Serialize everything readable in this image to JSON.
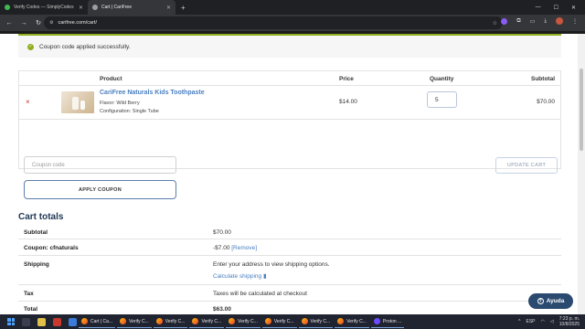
{
  "browser": {
    "tabs": [
      {
        "title": "Verify Codes — SimplyCodes",
        "fav_color": "#3fb950"
      },
      {
        "title": "Cart | CariFree",
        "fav_color": "#9aa0a6"
      }
    ],
    "url": "carifree.com/cart/"
  },
  "notice": {
    "message": "Coupon code applied successfully."
  },
  "cart": {
    "headers": {
      "product": "Product",
      "price": "Price",
      "quantity": "Quantity",
      "subtotal": "Subtotal"
    },
    "item": {
      "remove": "×",
      "name": "CariFree Naturals Kids Toothpaste",
      "flavor": "Flavor: Wild Berry",
      "configuration": "Configuration: Single Tube",
      "price": "$14.00",
      "quantity": "5",
      "subtotal": "$70.00"
    },
    "coupon_placeholder": "Coupon code",
    "apply_label": "APPLY COUPON",
    "update_label": "UPDATE CART"
  },
  "totals": {
    "heading": "Cart totals",
    "subtotal_label": "Subtotal",
    "subtotal_value": "$70.00",
    "coupon_label": "Coupon: cfnaturals",
    "coupon_value": "-$7.00",
    "coupon_remove": "[Remove]",
    "shipping_label": "Shipping",
    "shipping_text": "Enter your address to view shipping options.",
    "shipping_link": "Calculate shipping",
    "tax_label": "Tax",
    "tax_value": "Taxes will be calculated at checkout",
    "total_label": "Total",
    "total_value": "$63.00"
  },
  "help": {
    "label": "Ayuda"
  },
  "taskbar": {
    "apps": [
      "Cart | Ca...",
      "Verify C...",
      "Verify C...",
      "Verify C...",
      "Verify C...",
      "Verify C...",
      "Verify C...",
      "Verify C...",
      "Proton ..."
    ],
    "lang": "ESP",
    "time": "7:23 p. m.",
    "date": "10/8/2025"
  }
}
